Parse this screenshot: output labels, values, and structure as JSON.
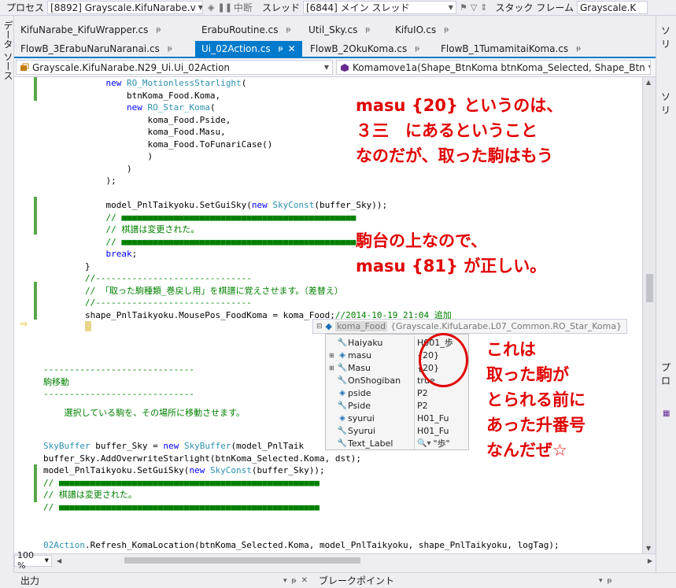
{
  "toolbar": {
    "process_label": "プロセス",
    "process_value": "[8892] Grayscale.KifuNarabe.v",
    "suspend_label": "中断",
    "thread_label": "スレッド",
    "thread_value": "[6844] メイン スレッド",
    "stack_label": "スタック フレーム",
    "stack_value": "Grayscale.K"
  },
  "left_panel_label": "データ ソース",
  "tabs_row1": [
    "KifuNarabe_KifuWrapper.cs",
    "ErabuRoutine.cs",
    "Util_Sky.cs",
    "KifuIO.cs"
  ],
  "tabs_row2": [
    "FlowB_3ErabuNaruNaranai.cs",
    "Ui_02Action.cs",
    "FlowB_2OkuKoma.cs",
    "FlowB_1TumamitaiKoma.cs"
  ],
  "nav": {
    "class_path": "Grayscale.KifuNarabe.N29_Ui.Ui_02Action",
    "member": "Komamove1a(Shape_BtnKoma btnKoma_Selected, Shape_Btn"
  },
  "code_lines": {
    "l1": {
      "pre": "            ",
      "kw": "new",
      "sp": " ",
      "ty": "RO_MotionlessStarlight",
      "post": "("
    },
    "l2": "                btnKoma_Food.Koma,",
    "l3": {
      "pre": "                ",
      "kw": "new",
      "sp": " ",
      "ty": "RO_Star_Koma",
      "post": "("
    },
    "l4": "                    koma_Food.Pside,",
    "l5": "                    koma_Food.Masu,",
    "l6": "                    koma_Food.ToFunariCase()",
    "l7": "                    )",
    "l8": "                )",
    "l9": "            );",
    "l10": {
      "pre": "            model_PnlTaikyoku.SetGuiSky(",
      "kw": "new",
      "sp": " ",
      "ty": "SkyConst",
      "post": "(buffer_Sky));"
    },
    "l11": "            // ■■■■■■■■■■■■■■■■■■■■■■■■■■■■■■■■■■■■■■■■■■■■■",
    "l12": "            // 棋譜は変更された。",
    "l13": "            // ■■■■■■■■■■■■■■■■■■■■■■■■■■■■■■■■■■■■■■■■■■■■■",
    "l14": {
      "pre": "            ",
      "kw": "break",
      "post": ";"
    },
    "l15": "        }",
    "l16": "        //------------------------------",
    "l17": "        // 「取った駒種類_巻戻し用」を棋譜に覚えさせます。（差替え）",
    "l18": "        //------------------------------",
    "l19": {
      "code": "        shape_PnlTaikyoku.MousePos_FoodKoma = koma_Food;",
      "comment": "//2014-10-19 21:04 追加"
    },
    "l21": "-----------------------------",
    "l22": "駒移動",
    "l23": "-----------------------------",
    "l24": "    選択している駒を、その場所に移動させます。",
    "l25": {
      "ty": "SkyBuffer",
      "mid": " buffer_Sky = ",
      "kw": "new",
      "sp": " ",
      "ty2": "SkyBuffer",
      "post": "(model_PnlTaik"
    },
    "l26": "buffer_Sky.AddOverwriteStarlight(btnKoma_Selected.Koma, dst);",
    "l27": {
      "pre": "model_PnlTaikyoku.SetGuiSky(",
      "kw": "new",
      "sp": " ",
      "ty": "SkyConst",
      "post": "(buffer_Sky));"
    },
    "l28": "// ■■■■■■■■■■■■■■■■■■■■■■■■■■■■■■■■■■■■■■■■■■■■■■■■■■",
    "l29": "// 棋譜は変更された。",
    "l30": "// ■■■■■■■■■■■■■■■■■■■■■■■■■■■■■■■■■■■■■■■■■■■■■■■■■■",
    "l31": {
      "ty": "02Action",
      "post": ".Refresh_KomaLocation(btnKoma_Selected.Koma, model_PnlTaikyoku, shape_PnlTaikyoku, logTag);"
    }
  },
  "tooltip": {
    "name": "koma_Food",
    "type": "{Grayscale.KifuLarabe.L07_Common.RO_Star_Koma}"
  },
  "datatip": [
    {
      "name": "Haiyaku",
      "value": "H001_歩"
    },
    {
      "name": "masu",
      "value": "{20}"
    },
    {
      "name": "Masu",
      "value": "{20}"
    },
    {
      "name": "OnShogiban",
      "value": "true"
    },
    {
      "name": "pside",
      "value": "P2"
    },
    {
      "name": "Pside",
      "value": "P2"
    },
    {
      "name": "syurui",
      "value": "H01_Fu"
    },
    {
      "name": "Syurui",
      "value": "H01_Fu"
    },
    {
      "name": "Text_Label",
      "value": "\"歩\""
    }
  ],
  "annotations": {
    "a1": "masu {20} というのは、\n３三　にあるということ\nなのだが、取った駒はもう",
    "a2": "駒台の上なので、\nmasu {81} が正しい。",
    "a3": "これは\n取った駒が\nとられる前に\nあった升番号\nなんだぜ☆"
  },
  "zoom": "100 %",
  "bottom": {
    "output": "出力",
    "breakpoints": "ブレークポイント"
  },
  "right_panel": {
    "top": "ソリ",
    "mid": "ソリ",
    "lower": "プロ"
  },
  "colors": {
    "accent": "#007acc",
    "annotation": "#e00000",
    "changebar": "#57a64a"
  }
}
